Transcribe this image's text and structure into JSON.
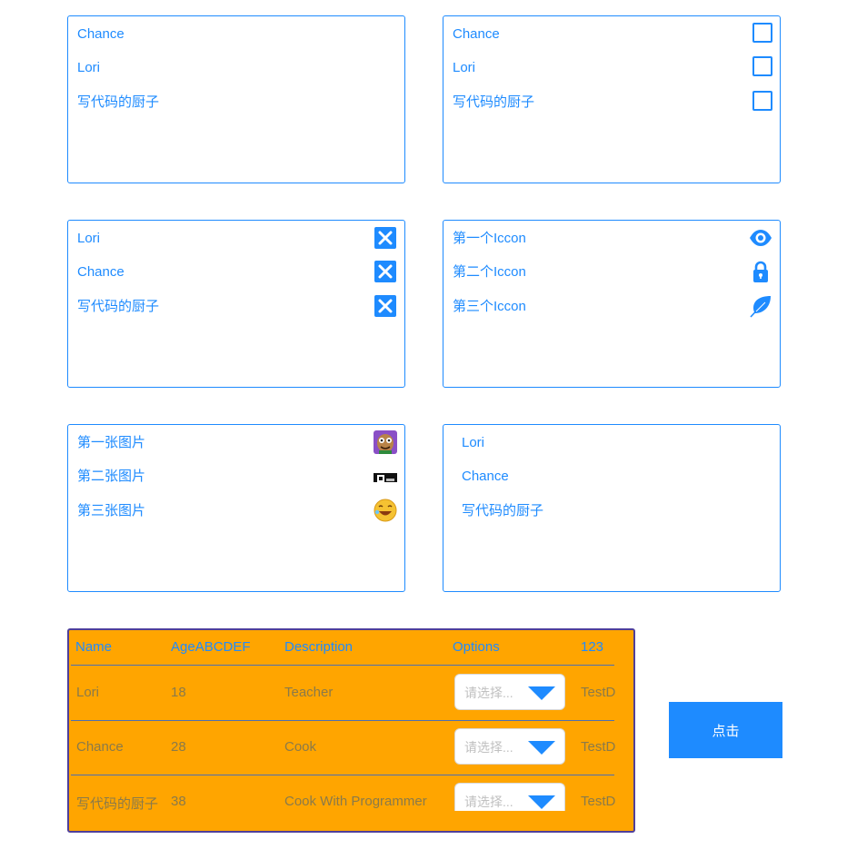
{
  "lists": {
    "plain": [
      "Chance",
      "Lori",
      "写代码的厨子"
    ],
    "checkbox": [
      "Chance",
      "Lori",
      "写代码的厨子"
    ],
    "close": [
      "Lori",
      "Chance",
      "写代码的厨子"
    ],
    "icons": {
      "labels": [
        "第一个Iccon",
        "第二个Iccon",
        "第三个Iccon"
      ],
      "names": [
        "eye-icon",
        "lock-icon",
        "leaf-icon"
      ]
    },
    "images": {
      "labels": [
        "第一张图片",
        "第二张图片",
        "第三张图片"
      ],
      "names": [
        "cartoon-face-image",
        "dark-screenshot-image",
        "laughing-emoji-image"
      ]
    },
    "indented": [
      "Lori",
      "Chance",
      "写代码的厨子"
    ]
  },
  "table": {
    "headers": [
      "Name",
      "AgeABCDEF",
      "Description",
      "Options",
      "123"
    ],
    "rows": [
      {
        "name": "Lori",
        "age": "18",
        "description": "Teacher",
        "option_placeholder": "请选择...",
        "extra": "TestD"
      },
      {
        "name": "Chance",
        "age": "28",
        "description": "Cook",
        "option_placeholder": "请选择...",
        "extra": "TestD"
      },
      {
        "name": "写代码的厨子",
        "age": "38",
        "description": "Cook With Programmer",
        "option_placeholder": "请选择...",
        "extra": "TestD"
      }
    ]
  },
  "action_button_label": "点击",
  "colors": {
    "accent": "#1e8bff",
    "table_background": "#ffa500",
    "table_border": "#4f3f9a"
  }
}
